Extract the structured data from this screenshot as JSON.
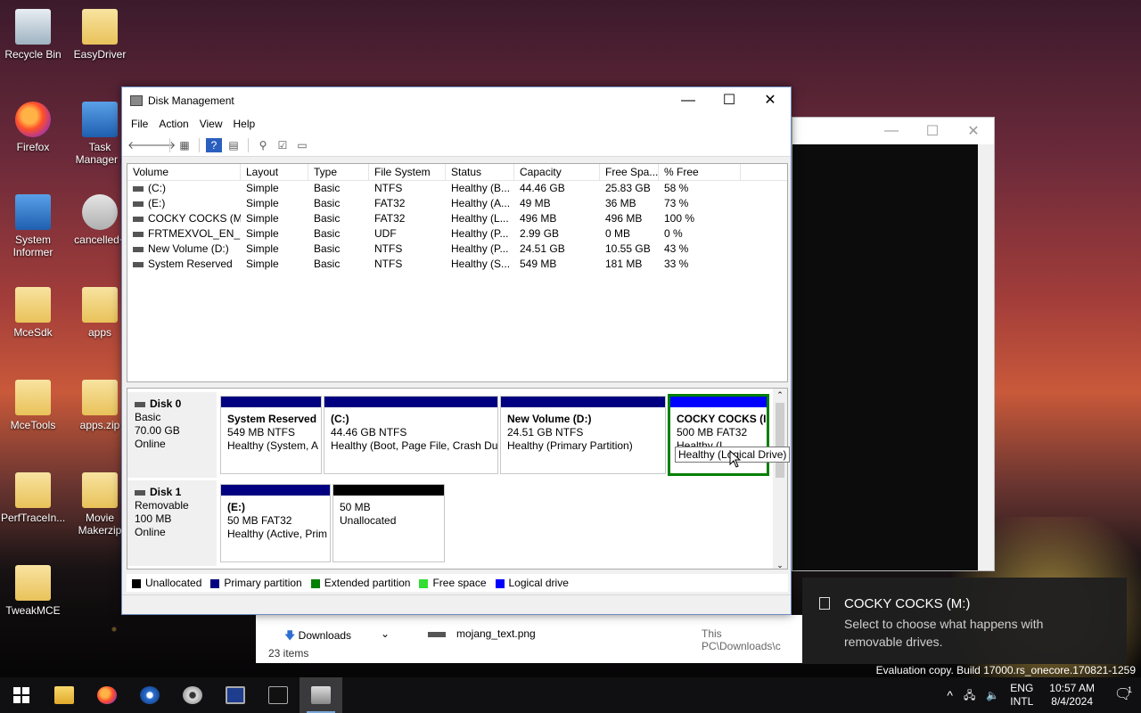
{
  "desktop": {
    "icons": [
      {
        "label": "Recycle Bin"
      },
      {
        "label": "EasyDriver"
      },
      {
        "label": "Firefox"
      },
      {
        "label": "Task Manager ("
      },
      {
        "label": "System Informer"
      },
      {
        "label": "cancelled+"
      },
      {
        "label": "MceSdk"
      },
      {
        "label": "apps"
      },
      {
        "label": "MceTools"
      },
      {
        "label": "apps.zip"
      },
      {
        "label": "PerfTraceIn..."
      },
      {
        "label": "Movie Makerzip"
      },
      {
        "label": "TweakMCE"
      }
    ]
  },
  "window": {
    "title": "Disk Management",
    "menu": [
      "File",
      "Action",
      "View",
      "Help"
    ],
    "columns": [
      "Volume",
      "Layout",
      "Type",
      "File System",
      "Status",
      "Capacity",
      "Free Spa...",
      "% Free"
    ],
    "rows": [
      [
        "(C:)",
        "Simple",
        "Basic",
        "NTFS",
        "Healthy (B...",
        "44.46 GB",
        "25.83 GB",
        "58 %"
      ],
      [
        "(E:)",
        "Simple",
        "Basic",
        "FAT32",
        "Healthy (A...",
        "49 MB",
        "36 MB",
        "73 %"
      ],
      [
        "COCKY COCKS (M:)",
        "Simple",
        "Basic",
        "FAT32",
        "Healthy (L...",
        "496 MB",
        "496 MB",
        "100 %"
      ],
      [
        "FRTMEXVOL_EN_...",
        "Simple",
        "Basic",
        "UDF",
        "Healthy (P...",
        "2.99 GB",
        "0 MB",
        "0 %"
      ],
      [
        "New Volume (D:)",
        "Simple",
        "Basic",
        "NTFS",
        "Healthy (P...",
        "24.51 GB",
        "10.55 GB",
        "43 %"
      ],
      [
        "System Reserved",
        "Simple",
        "Basic",
        "NTFS",
        "Healthy (S...",
        "549 MB",
        "181 MB",
        "33 %"
      ]
    ],
    "disks": [
      {
        "name": "Disk 0",
        "kind": "Basic",
        "size": "70.00 GB",
        "state": "Online",
        "partitions": [
          {
            "name": "System Reserved",
            "size": "549 MB NTFS",
            "status": "Healthy (System, A"
          },
          {
            "name": "(C:)",
            "size": "44.46 GB NTFS",
            "status": "Healthy (Boot, Page File, Crash Du"
          },
          {
            "name": "New Volume  (D:)",
            "size": "24.51 GB NTFS",
            "status": "Healthy (Primary Partition)"
          },
          {
            "name": "COCKY COCKS  (I",
            "size": "500 MB FAT32",
            "status": "Healthy (I"
          }
        ]
      },
      {
        "name": "Disk 1",
        "kind": "Removable",
        "size": "100 MB",
        "state": "Online",
        "partitions": [
          {
            "name": "(E:)",
            "size": "50 MB FAT32",
            "status": "Healthy (Active, Prim"
          },
          {
            "name": "",
            "size": "50 MB",
            "status": "Unallocated"
          }
        ]
      }
    ],
    "tooltip": "Healthy (Logical Drive)",
    "legend": [
      {
        "label": "Unallocated",
        "color": "#000000"
      },
      {
        "label": "Primary partition",
        "color": "#000080"
      },
      {
        "label": "Extended partition",
        "color": "#008000"
      },
      {
        "label": "Free space",
        "color": "#33dd33"
      },
      {
        "label": "Logical drive",
        "color": "#0000ff"
      }
    ]
  },
  "explorer": {
    "nav_item": "Downloads",
    "file": "mojang_text.png",
    "path": "This PC\\Downloads\\c",
    "count": "23 items"
  },
  "toast": {
    "title": "COCKY COCKS (M:)",
    "message": "Select to choose what happens with removable drives."
  },
  "watermark": "Evaluation copy. Build 17000.rs_onecore.170821-1259",
  "tray": {
    "lang1": "ENG",
    "lang2": "INTL",
    "time": "10:57 AM",
    "date": "8/4/2024",
    "notif_count": "1"
  }
}
